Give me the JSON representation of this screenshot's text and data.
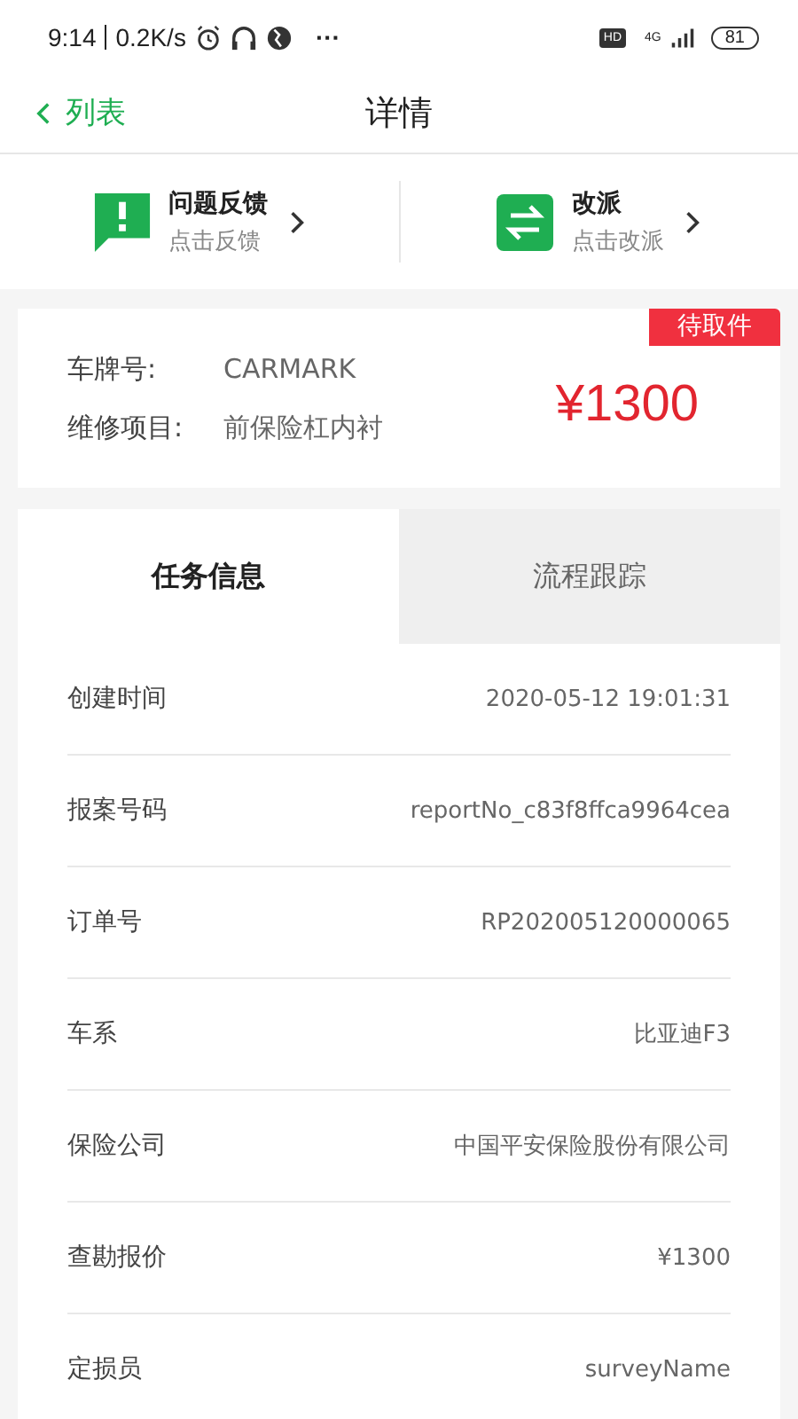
{
  "status_bar": {
    "time": "9:14",
    "speed": "0.2K/s",
    "more": "···",
    "hd": "HD",
    "network": "4G",
    "battery": "81"
  },
  "nav": {
    "back": "列表",
    "title": "详情"
  },
  "actions": [
    {
      "kind": "feedback",
      "title": "问题反馈",
      "subtitle": "点击反馈"
    },
    {
      "kind": "reassign",
      "title": "改派",
      "subtitle": "点击改派"
    }
  ],
  "summary": {
    "badge": "待取件",
    "fields": [
      {
        "label": "车牌号:",
        "value": "CARMARK"
      },
      {
        "label": "维修项目:",
        "value": "前保险杠内衬"
      }
    ],
    "price": "¥1300"
  },
  "tabs": [
    {
      "label": "任务信息",
      "selected": true
    },
    {
      "label": "流程跟踪",
      "selected": false
    }
  ],
  "rows": [
    {
      "label": "创建时间",
      "value": "2020-05-12 19:01:31"
    },
    {
      "label": "报案号码",
      "value": "reportNo_c83f8ffca9964cea"
    },
    {
      "label": "订单号",
      "value": "RP202005120000065"
    },
    {
      "label": "车系",
      "value": "比亚迪F3"
    },
    {
      "label": "保险公司",
      "value": "中国平安保险股份有限公司"
    },
    {
      "label": "查勘报价",
      "value": "¥1300"
    },
    {
      "label": "定损员",
      "value": "surveyName"
    }
  ]
}
